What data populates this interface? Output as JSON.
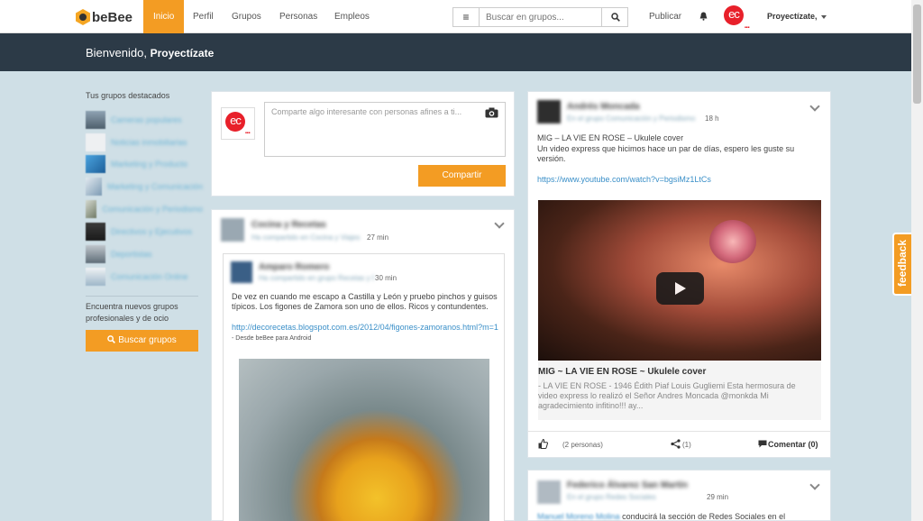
{
  "nav": {
    "logo": "beBee",
    "tabs": [
      "Inicio",
      "Perfil",
      "Grupos",
      "Personas",
      "Empleos"
    ],
    "search_placeholder": "Buscar en grupos...",
    "publish": "Publicar",
    "avatar_initials": "ec",
    "avatar_dots": "...",
    "user_name": "Proyectízate,"
  },
  "banner": {
    "greeting": "Bienvenido,",
    "name": "Proyectízate"
  },
  "sidebar": {
    "title": "Tus grupos destacados",
    "groups": [
      "Cameras populares",
      "Noticias inmobiliarias",
      "Marketing y Producto",
      "Marketing y Comunicación",
      "Comunicación y Periodismo",
      "Directivos y Ejecutivos",
      "Deportistas",
      "Comunicación Online"
    ],
    "hint": "Encuentra nuevos grupos profesionales y de ocio",
    "search_button": "Buscar grupos"
  },
  "composer": {
    "placeholder": "Comparte algo interesante con personas afines a ti...",
    "share_button": "Compartir"
  },
  "post_left": {
    "author": "Cocina y Recetas",
    "meta": "Ha compartido en Cocina y Viajes",
    "time": "27 min",
    "inner": {
      "author": "Amparo Romero",
      "meta": "Ha compartido en grupo Recetas y Degustaciones",
      "time": "30 min",
      "text": "De vez en cuando me escapo a Castilla y León y pruebo pinchos y guisos típicos. Los figones de Zamora son uno de ellos. Ricos y contundentes.",
      "link": "http://decorecetas.blogspot.com.es/2012/04/figones-zamoranos.html?m=1",
      "source": "- Desde beBee para Android"
    }
  },
  "post_right": {
    "author": "Andrés Moncada",
    "meta": "En el grupo Comunicación y Periodismo",
    "time": "18 h",
    "title": "MIG – LA VIE EN ROSE – Ukulele cover",
    "text": "Un video express que hicimos hace un par de días, espero les guste su versión.",
    "link": "https://www.youtube.com/watch?v=bgsiMz1LtCs",
    "video_title": "MIG ~ LA VIE EN ROSE ~ Ukulele cover",
    "video_desc": "- LA VIE EN ROSE - 1946 Édith Piaf Louis Gugliemi Esta hermosura de video express lo realizó el Señor Andres Moncada @monkda Mi agradecimiento infitino!!! ay...",
    "likes": "(2 personas)",
    "shares": "(1)",
    "comment": "Comentar (0)"
  },
  "post_right2": {
    "author": "Federico Álvarez San Martín",
    "meta": "En el grupo Redes Sociales",
    "time": "29 min",
    "text_start": "Manuel Moreno Molina",
    "text": "conducirá la sección de Redes Sociales en el"
  },
  "feedback": "feedback",
  "colors": {
    "accent": "#f39c23",
    "banner": "#2c3a47",
    "link": "#3a8fc8",
    "avatar": "#e8202a"
  }
}
